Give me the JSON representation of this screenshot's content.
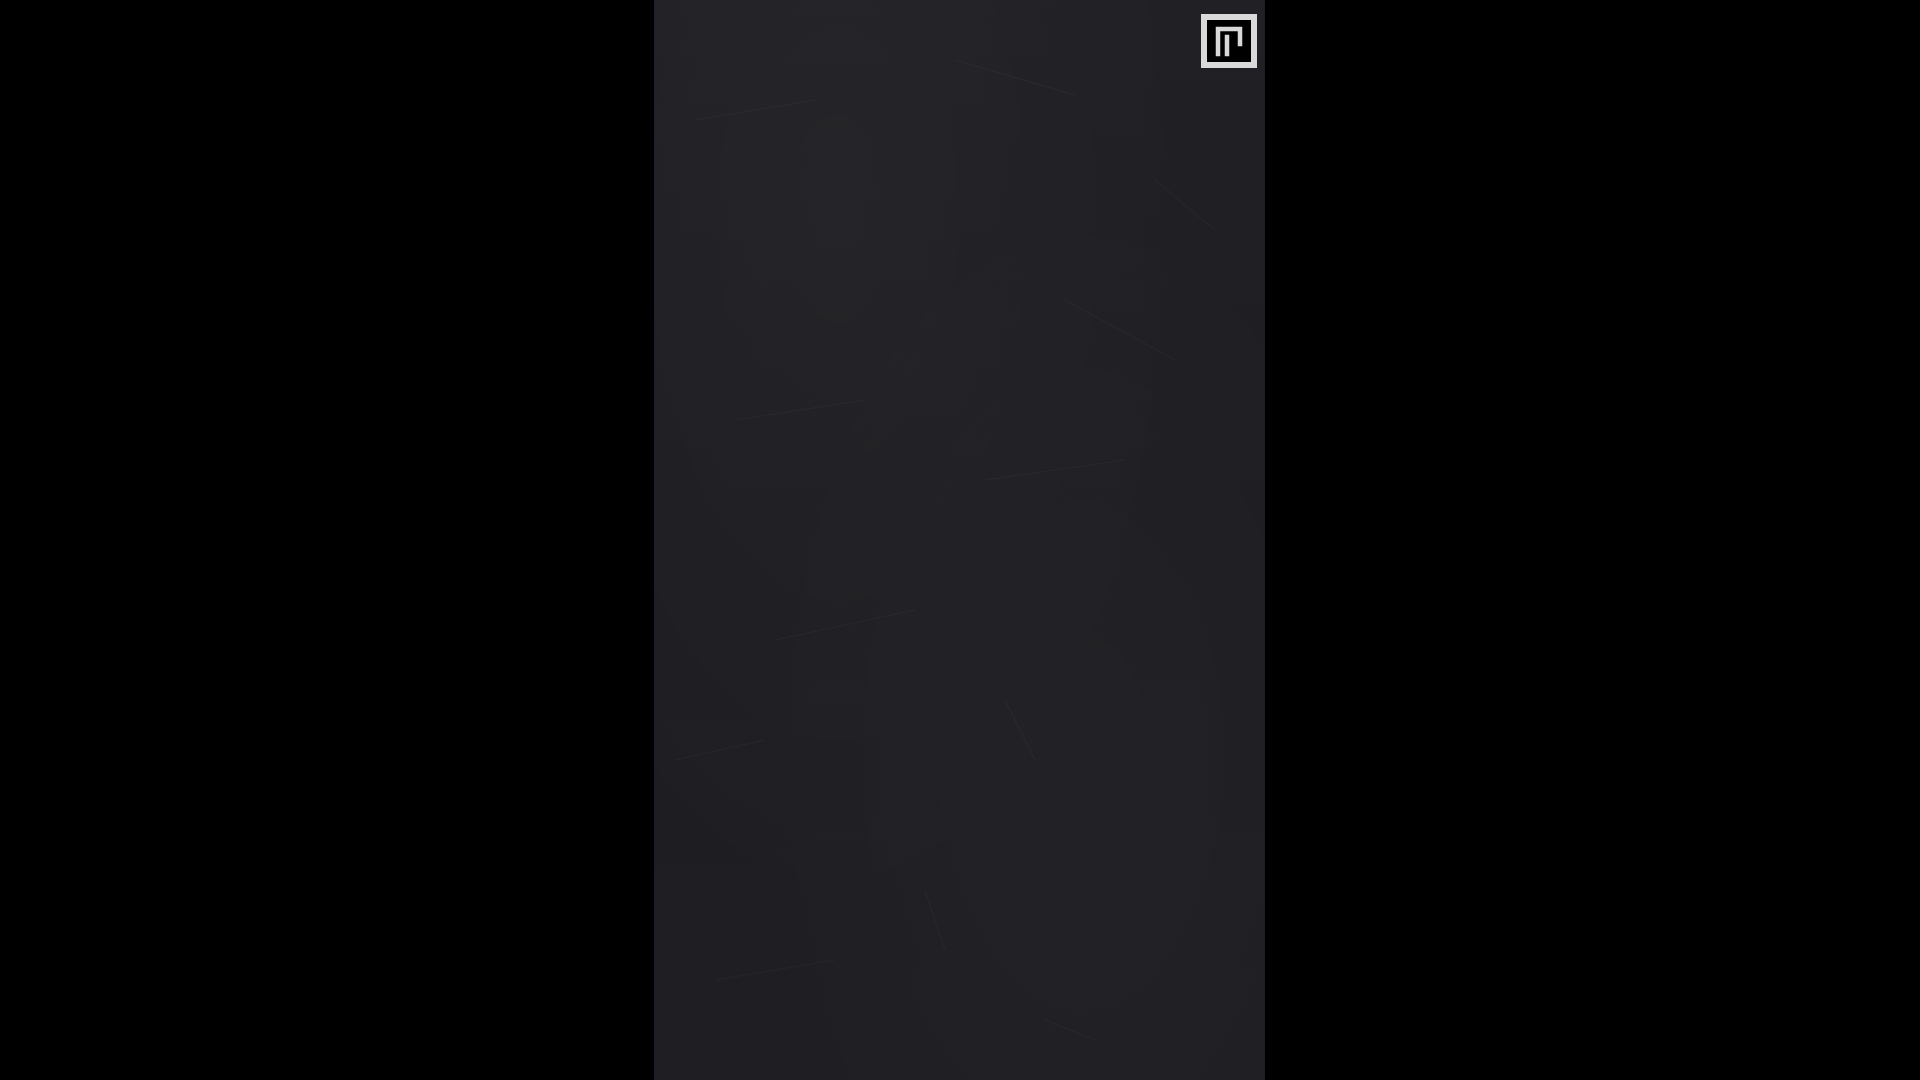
{
  "colors": {
    "letterbox": "#000000",
    "canvas": "#202024",
    "canvas_edge": "#1a1d2a",
    "button_frame": "#d9d9d9",
    "button_fill": "#000000",
    "icon": "#d9d9d9"
  },
  "game": {
    "fullscreen_button": {
      "icon": "fullscreen-icon"
    }
  }
}
